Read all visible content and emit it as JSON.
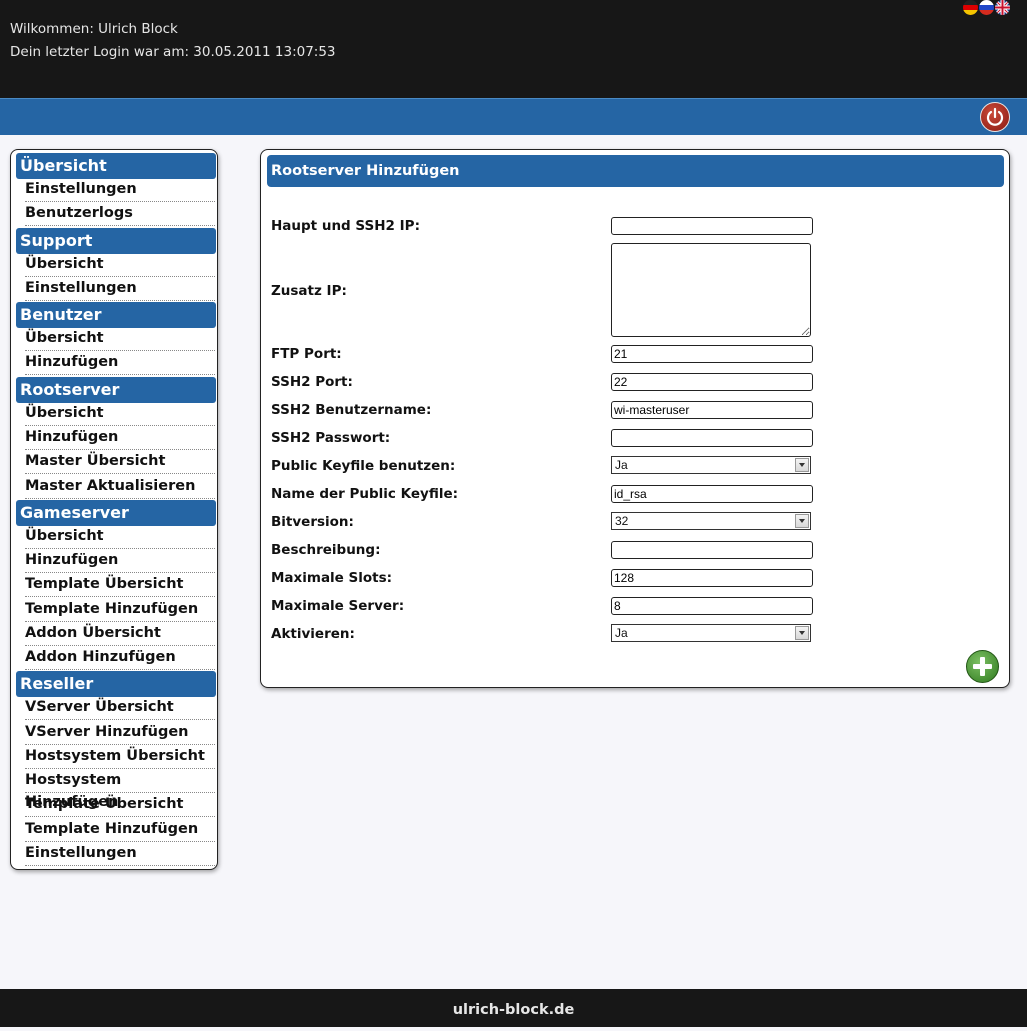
{
  "header": {
    "welcome": "Wilkommen: Ulrich Block",
    "last_login": "Dein letzter Login war am: 30.05.2011 13:07:53",
    "flags": [
      "de-flag-icon",
      "ru-flag-icon",
      "uk-flag-icon"
    ],
    "logout_icon": "power-icon"
  },
  "sidebar": {
    "sections": [
      {
        "title": "Übersicht",
        "items": [
          "Einstellungen",
          "Benutzerlogs"
        ]
      },
      {
        "title": "Support",
        "items": [
          "Übersicht",
          "Einstellungen"
        ]
      },
      {
        "title": "Benutzer",
        "items": [
          "Übersicht",
          "Hinzufügen"
        ]
      },
      {
        "title": "Rootserver",
        "items": [
          "Übersicht",
          "Hinzufügen",
          "Master Übersicht",
          "Master Aktualisieren"
        ]
      },
      {
        "title": "Gameserver",
        "items": [
          "Übersicht",
          "Hinzufügen",
          "Template Übersicht",
          "Template Hinzufügen",
          "Addon Übersicht",
          "Addon Hinzufügen"
        ]
      },
      {
        "title": "Reseller",
        "items": [
          "VServer Übersicht",
          "VServer Hinzufügen",
          "Hostsystem Übersicht",
          "Hostsystem Hinzufügen",
          "Template Übersicht",
          "Template Hinzufügen",
          "Einstellungen"
        ]
      }
    ]
  },
  "form": {
    "title": "Rootserver Hinzufügen",
    "fields": [
      {
        "label": "Haupt und SSH2 IP:",
        "type": "input",
        "value": ""
      },
      {
        "label": "Zusatz IP:",
        "type": "textarea",
        "value": ""
      },
      {
        "label": "FTP Port:",
        "type": "input",
        "value": "21"
      },
      {
        "label": "SSH2 Port:",
        "type": "input",
        "value": "22"
      },
      {
        "label": "SSH2 Benutzername:",
        "type": "input",
        "value": "wi-masteruser"
      },
      {
        "label": "SSH2 Passwort:",
        "type": "input",
        "value": ""
      },
      {
        "label": "Public Keyfile benutzen:",
        "type": "select",
        "value": "Ja"
      },
      {
        "label": "Name der Public Keyfile:",
        "type": "input",
        "value": "id_rsa"
      },
      {
        "label": "Bitversion:",
        "type": "select",
        "value": "32"
      },
      {
        "label": "Beschreibung:",
        "type": "input",
        "value": ""
      },
      {
        "label": "Maximale Slots:",
        "type": "input",
        "value": "128"
      },
      {
        "label": "Maximale Server:",
        "type": "input",
        "value": "8"
      },
      {
        "label": "Aktivieren:",
        "type": "select",
        "value": "Ja"
      }
    ],
    "submit_icon": "add-icon"
  },
  "footer": {
    "text": "ulrich-block.de"
  },
  "colors": {
    "accent": "#2565a4",
    "dark": "#171717",
    "add": "#3f8f2a",
    "logout": "#a02a1e"
  }
}
